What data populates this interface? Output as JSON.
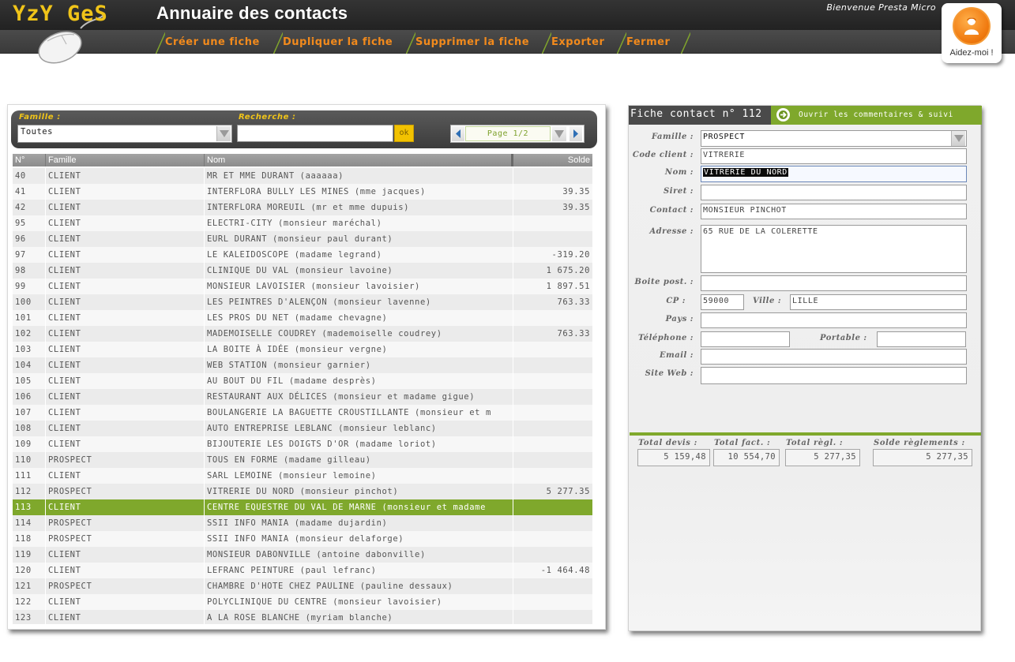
{
  "header": {
    "logo": "YzY GeS",
    "app_title": "Annuaire des contacts",
    "welcome": "Bienvenue Presta Micro",
    "help_label": "Aidez-moi !",
    "menu": [
      "Créer une fiche",
      "Dupliquer la fiche",
      "Supprimer la fiche",
      "Exporter",
      "Fermer"
    ]
  },
  "filters": {
    "famille_label": "Famille :",
    "famille_value": "Toutes",
    "recherche_label": "Recherche :",
    "recherche_value": "",
    "ok_label": "ok",
    "page_label": "Page 1/2"
  },
  "grid": {
    "columns": [
      "N°",
      "Famille",
      "Nom",
      "Solde"
    ],
    "selected_index": 21,
    "rows": [
      [
        "40",
        "CLIENT",
        "MR ET MME DURANT (aaaaaa)",
        ""
      ],
      [
        "41",
        "CLIENT",
        "INTERFLORA BULLY LES MINES (mme jacques)",
        "39.35"
      ],
      [
        "42",
        "CLIENT",
        "INTERFLORA MOREUIL (mr et mme dupuis)",
        "39.35"
      ],
      [
        "95",
        "CLIENT",
        "ELECTRI-CITY (monsieur maréchal)",
        ""
      ],
      [
        "96",
        "CLIENT",
        "EURL DURANT (monsieur paul durant)",
        ""
      ],
      [
        "97",
        "CLIENT",
        "LE KALEIDOSCOPE (madame legrand)",
        "-319.20"
      ],
      [
        "98",
        "CLIENT",
        "CLINIQUE DU VAL (monsieur lavoine)",
        "1 675.20"
      ],
      [
        "99",
        "CLIENT",
        "MONSIEUR LAVOISIER (monsieur lavoisier)",
        "1 897.51"
      ],
      [
        "100",
        "CLIENT",
        "LES PEINTRES D'ALENÇON (monsieur lavenne)",
        "763.33"
      ],
      [
        "101",
        "CLIENT",
        "LES PROS DU NET (madame chevagne)",
        ""
      ],
      [
        "102",
        "CLIENT",
        "MADEMOISELLE COUDREY (mademoiselle coudrey)",
        "763.33"
      ],
      [
        "103",
        "CLIENT",
        "LA BOITE À IDÉE (monsieur vergne)",
        ""
      ],
      [
        "104",
        "CLIENT",
        "WEB STATION (monsieur garnier)",
        ""
      ],
      [
        "105",
        "CLIENT",
        "AU BOUT DU FIL (madame desprès)",
        ""
      ],
      [
        "106",
        "CLIENT",
        "RESTAURANT AUX DÉLICES (monsieur et madame gigue)",
        ""
      ],
      [
        "107",
        "CLIENT",
        "BOULANGERIE LA BAGUETTE CROUSTILLANTE (monsieur et m",
        ""
      ],
      [
        "108",
        "CLIENT",
        "AUTO ENTREPRISE LEBLANC (monsieur leblanc)",
        ""
      ],
      [
        "109",
        "CLIENT",
        "BIJOUTERIE LES DOIGTS D'OR (madame loriot)",
        ""
      ],
      [
        "110",
        "PROSPECT",
        "TOUS EN FORME (madame gilleau)",
        ""
      ],
      [
        "111",
        "CLIENT",
        "SARL LEMOINE (monsieur lemoine)",
        ""
      ],
      [
        "112",
        "PROSPECT",
        "VITRERIE DU NORD (monsieur pinchot)",
        "5 277.35"
      ],
      [
        "113",
        "CLIENT",
        "CENTRE EQUESTRE DU VAL DE MARNE (monsieur et madame",
        ""
      ],
      [
        "114",
        "PROSPECT",
        "SSII INFO MANIA (madame dujardin)",
        ""
      ],
      [
        "118",
        "PROSPECT",
        "SSII INFO MANIA (monsieur delaforge)",
        ""
      ],
      [
        "119",
        "CLIENT",
        "MONSIEUR DABONVILLE (antoine dabonville)",
        ""
      ],
      [
        "120",
        "CLIENT",
        "LEFRANC PEINTURE (paul lefranc)",
        "-1 464.48"
      ],
      [
        "121",
        "PROSPECT",
        "CHAMBRE D'HOTE CHEZ PAULINE (pauline dessaux)",
        ""
      ],
      [
        "122",
        "CLIENT",
        "POLYCLINIQUE DU CENTRE (monsieur lavoisier)",
        ""
      ],
      [
        "123",
        "CLIENT",
        "A LA ROSE BLANCHE (myriam blanche)",
        ""
      ]
    ]
  },
  "fiche": {
    "title": "Fiche contact n° 112",
    "comments_link": "Ouvrir les commentaires & suivi",
    "labels": {
      "famille": "Famille :",
      "code_client": "Code client :",
      "nom": "Nom :",
      "siret": "Siret :",
      "contact": "Contact :",
      "adresse": "Adresse :",
      "boite_post": "Boite post. :",
      "cp": "CP :",
      "ville": "Ville :",
      "pays": "Pays :",
      "telephone": "Téléphone :",
      "portable": "Portable :",
      "email": "Email :",
      "site_web": "Site Web :"
    },
    "values": {
      "famille": "PROSPECT",
      "code_client": "VITRERIE",
      "nom": "VITRERIE DU NORD",
      "siret": "",
      "contact": "MONSIEUR PINCHOT",
      "adresse": "65 RUE DE LA COLERETTE",
      "boite_post": "",
      "cp": "59000",
      "ville": "LILLE",
      "pays": "",
      "telephone": "",
      "portable": "",
      "email": "",
      "site_web": ""
    },
    "totals": {
      "labels": [
        "Total devis :",
        "Total fact. :",
        "Total règl. :",
        "Solde règlements :"
      ],
      "values": [
        "5 159,48",
        "10 554,70",
        "5 277,35",
        "5 277,35"
      ]
    }
  },
  "colors": {
    "accent_green": "#7fa82c",
    "menu_orange": "#f28a1c",
    "label_yellow": "#f0c419",
    "help_orange": "#f07a10"
  }
}
